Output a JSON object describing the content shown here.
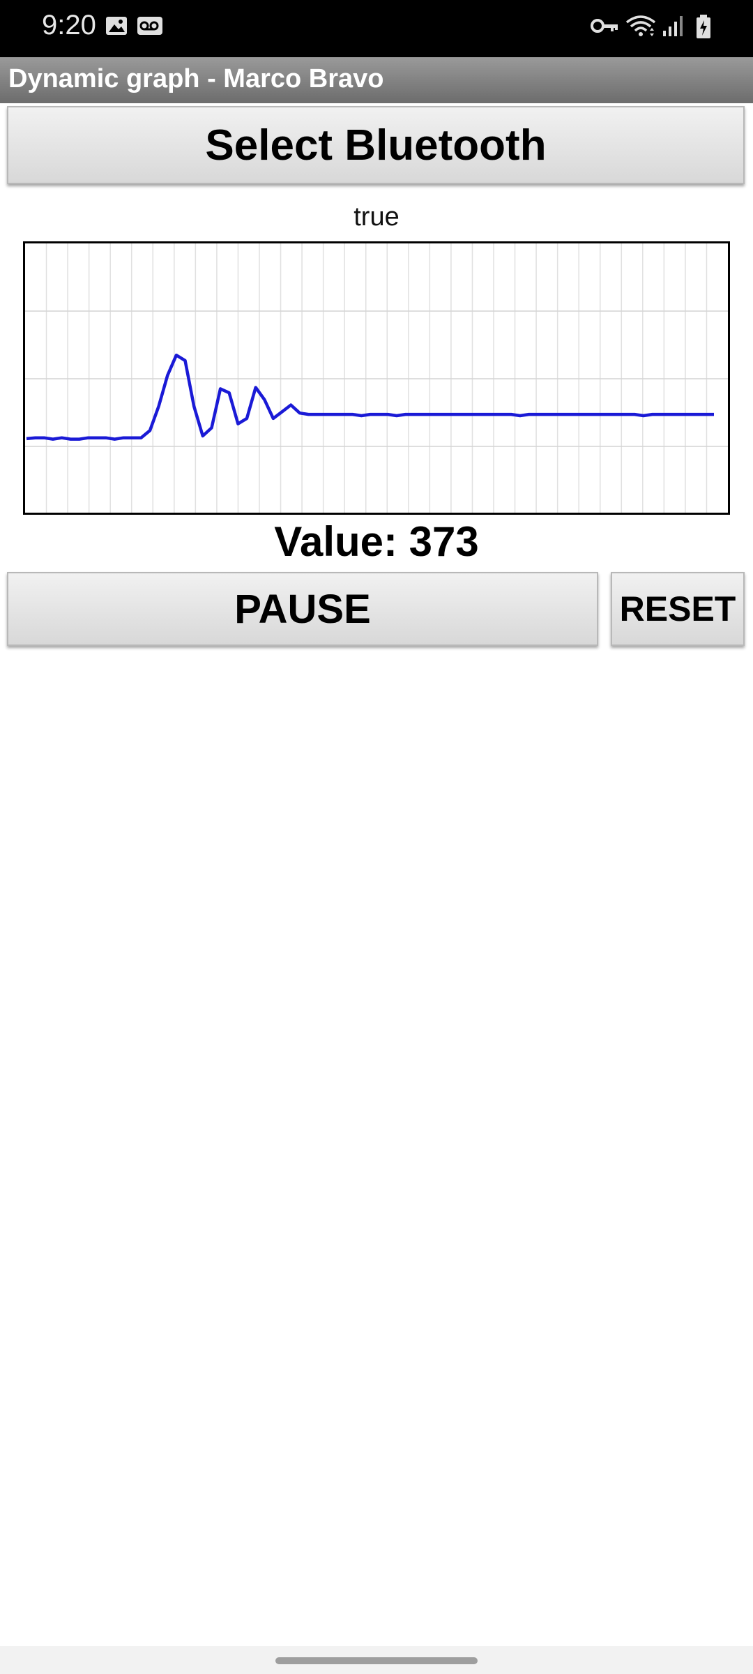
{
  "status_bar": {
    "time": "9:20",
    "left_icons": [
      "image-icon",
      "voicemail-icon"
    ],
    "right_icons": [
      "vpn-key-icon",
      "wifi-icon",
      "signal-icon",
      "battery-charging-icon"
    ]
  },
  "app": {
    "title": "Dynamic graph - Marco Bravo"
  },
  "main": {
    "bluetooth_button": "Select Bluetooth",
    "connection_status": "true",
    "value_label": "Value: 373",
    "pause_button": "PAUSE",
    "reset_button": "RESET"
  },
  "colors": {
    "line": "#1a1ad6",
    "title_bar": "#7d7d7d",
    "grid": "#e0e0e0"
  },
  "chart_data": {
    "type": "line",
    "title": "",
    "xlabel": "",
    "ylabel": "",
    "grid": true,
    "legend": "none",
    "ylim": [
      0,
      1000
    ],
    "xlim": [
      0,
      78
    ],
    "series": [
      {
        "x": [
          0,
          1,
          2,
          3,
          4,
          5,
          6,
          7,
          8,
          9,
          10,
          11,
          12,
          13,
          14,
          15,
          16,
          17,
          18,
          19,
          20,
          21,
          22,
          23,
          24,
          25,
          26,
          27,
          28,
          29,
          30,
          31,
          32,
          33,
          34,
          35,
          36,
          37,
          38,
          39,
          40,
          41,
          42,
          43,
          44,
          45,
          46,
          47,
          48,
          49,
          50,
          51,
          52,
          53,
          54,
          55,
          56,
          57,
          58,
          59,
          60,
          61,
          62,
          63,
          64,
          65,
          66,
          67,
          68,
          69,
          70,
          71,
          72,
          73,
          74,
          75,
          76,
          77,
          78
        ],
        "y": [
          275,
          278,
          278,
          273,
          278,
          273,
          273,
          278,
          278,
          278,
          273,
          278,
          278,
          278,
          305,
          395,
          510,
          585,
          565,
          395,
          285,
          315,
          460,
          445,
          330,
          350,
          465,
          420,
          350,
          375,
          400,
          370,
          365,
          365,
          365,
          365,
          365,
          365,
          360,
          365,
          365,
          365,
          360,
          365,
          365,
          365,
          365,
          365,
          365,
          365,
          365,
          365,
          365,
          365,
          365,
          365,
          360,
          365,
          365,
          365,
          365,
          365,
          365,
          365,
          365,
          365,
          365,
          365,
          365,
          365,
          360,
          365,
          365,
          365,
          365,
          365,
          365,
          365,
          365
        ]
      }
    ]
  }
}
